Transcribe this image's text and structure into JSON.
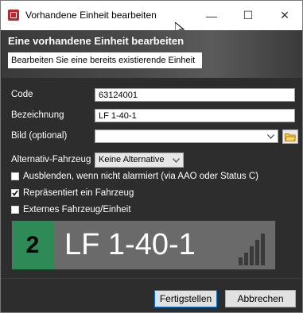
{
  "window": {
    "title": "Vorhandene Einheit bearbeiten",
    "controls": {
      "minimize": "—",
      "maximize": "☐",
      "close": "✕"
    }
  },
  "header": {
    "title": "Eine vorhandene Einheit bearbeiten",
    "subtitle": "Bearbeiten Sie eine bereits existierende Einheit"
  },
  "form": {
    "code_label": "Code",
    "code_value": "63124001",
    "name_label": "Bezeichnung",
    "name_value": "LF 1-40-1",
    "image_label": "Bild (optional)",
    "image_value": "",
    "alt_vehicle_label": "Alternativ-Fahrzeug",
    "alt_vehicle_selected": "Keine Alternative"
  },
  "checkboxes": [
    {
      "label": "Ausblenden, wenn nicht alarmiert (via AAO oder Status C)",
      "checked": false
    },
    {
      "label": "Repräsentiert ein Fahrzeug",
      "checked": true
    },
    {
      "label": "Externes Fahrzeug/Einheit",
      "checked": false
    }
  ],
  "preview": {
    "status": "2",
    "name": "LF 1-40-1",
    "status_color": "#2e8b57",
    "signal_icon": "signal-strength-icon"
  },
  "buttons": {
    "finish": "Fertigstellen",
    "cancel": "Abbrechen"
  },
  "icons": {
    "app": "app-icon",
    "folder": "folder-icon",
    "dropdown": "chevron-down-icon"
  }
}
